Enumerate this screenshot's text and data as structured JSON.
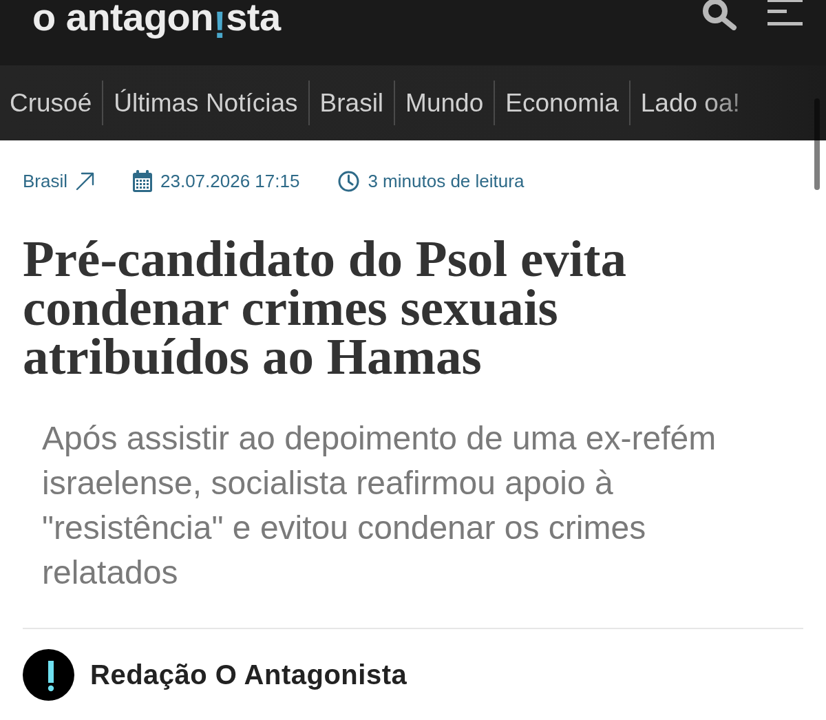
{
  "header": {
    "logo": {
      "before": "o antagon",
      "accent": "!",
      "after": "sta"
    }
  },
  "nav": {
    "items": [
      {
        "label": "Crusoé"
      },
      {
        "label": "Últimas Notícias"
      },
      {
        "label": "Brasil"
      },
      {
        "label": "Mundo"
      },
      {
        "label": "Economia"
      },
      {
        "label": "Lado oa!"
      }
    ]
  },
  "article": {
    "category": "Brasil",
    "date": "23.07.2026 17:15",
    "reading_time": "3 minutos de leitura",
    "headline": "Pré-candidato do Psol evita condenar crimes sexuais atribuídos ao Hamas",
    "subtitle": "Após assistir ao depoimento de uma ex-refém israelense, socialista reafirmou apoio à \"resistência\" e evitou condenar os crimes relatados",
    "author": "Redação O Antagonista"
  }
}
